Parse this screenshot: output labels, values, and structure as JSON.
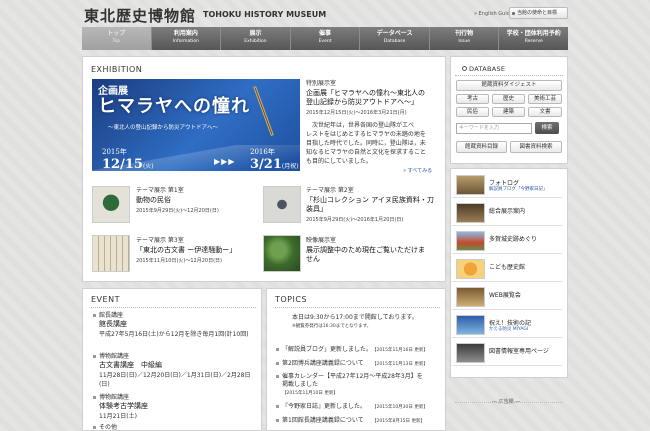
{
  "header": {
    "logo_jp": "東北歴史博物館",
    "logo_en": "TOHOKU HISTORY MUSEUM",
    "english_link": "» English Guide",
    "mission_button": "当館の使命と目標"
  },
  "nav": [
    {
      "jp": "トップ",
      "en": "Top",
      "active": true
    },
    {
      "jp": "利用案内",
      "en": "Information",
      "active": false
    },
    {
      "jp": "展示",
      "en": "Exhibition",
      "active": false
    },
    {
      "jp": "催事",
      "en": "Event",
      "active": false
    },
    {
      "jp": "データベース",
      "en": "Database",
      "active": false
    },
    {
      "jp": "刊行物",
      "en": "Issue",
      "active": false
    },
    {
      "jp": "学校・団体利用予約",
      "en": "Reserve",
      "active": false
    }
  ],
  "exhibition": {
    "section_title": "EXHIBITION",
    "banner": {
      "line1": "企画展",
      "line2": "ヒマラヤへの憧れ",
      "line3": "〜東北人の登山記録から防災アウトドアへ〜",
      "start_year": "2015年",
      "start_day": "12/15",
      "start_dow": "(火)",
      "end_year": "2016年",
      "end_day": "3/21",
      "end_dow": "(月祝)",
      "arrows": "▶▶▶"
    },
    "special": {
      "label": "特別展示室",
      "title_line1": "企画展「ヒマラヤへの憧れ〜東北人の",
      "title_line2": "登山記録から防災アウトドアへ〜」",
      "date": "2015年12月15日(火)〜2016年3月21日(月)",
      "body": [
        "　次世紀年は，世界各国の登山隊がエベ",
        "レストをはじめとするヒマラヤの未踏の地を",
        "目指した時代でした。同時に，登山隊は，未",
        "知なるヒマラヤの自然と文化を探求すること",
        "も目的にしていました。"
      ],
      "more": "» すべてみる"
    },
    "items": [
      {
        "label": "テーマ展示 第1室",
        "title": "動物の民俗",
        "date": "2015年9月29日(火)〜12月20日(日)"
      },
      {
        "label": "テーマ展示 第2室",
        "title_line1": "「杉山コレクション アイヌ民族資料・刀",
        "title_line2": "装具」",
        "date": "2015年9月29日(火)〜2016年1月20日(日)"
      },
      {
        "label": "テーマ展示 第3室",
        "title": "「東北の古文書 ー伊達騒動ー」",
        "date": "2015年11月10日(火)〜12月20日(日)"
      },
      {
        "label": "映像展示室",
        "title_line1": "展示調整中のため現在ご覧いただけま",
        "title_line2": "せん"
      }
    ]
  },
  "event": {
    "section_title": "EVENT",
    "items": [
      {
        "category": "館長講座",
        "title": "館長講座",
        "details": [
          "平成27年5月16日(土)から12月を除き毎月1回(計10回)"
        ]
      },
      {
        "category": "博物館講座",
        "title": "古文書講座　中級編",
        "details": [
          "11月28日(日)／12月20日(日)／1月31日(日)／2月28日(日)"
        ]
      },
      {
        "category": "博物館講座",
        "title": "体験考古学講座",
        "details": [
          "11月21日(土)"
        ]
      },
      {
        "category": "その他",
        "title": "",
        "details": []
      }
    ]
  },
  "topics": {
    "section_title": "TOPICS",
    "notice_line1": "本日は9:30から17:00まで開館しております。",
    "notice_line2": "※観覧券発行は16:30までとなります。",
    "items": [
      {
        "text": "「解説員ブログ」更新しました。",
        "date": "【2015年11月16日 更新】"
      },
      {
        "text": "第2回博兵講座講義録について",
        "date": "【2015年11月13日 更新】"
      },
      {
        "text_line1": "催事カレンダー【平成27年12月〜平成28年3月】を",
        "text_line2": "掲載しました",
        "date": "【2015年11月10日 更新】"
      },
      {
        "text": "『今野家日誌』更新しました。",
        "date": "【2015年10月30日 更新】"
      },
      {
        "text": "第1回館長講座講義録について",
        "date": "【2015年8月15日 更新】"
      }
    ]
  },
  "sidebar": {
    "database_title": "DATABASE",
    "digest_button": "館蔵資料ダイジェスト",
    "grid_buttons": [
      "考古",
      "歴史",
      "美術工芸",
      "民俗",
      "建築",
      "文書"
    ],
    "keyword_placeholder": "キーワードを入力",
    "search_button": "検索",
    "bottom_buttons": [
      "館蔵資料目録",
      "図書資料検索"
    ],
    "links": [
      {
        "label": "フォトログ",
        "sub": "解説員ブログ「今野家日記」"
      },
      {
        "label": "総合展示案内",
        "sub": ""
      },
      {
        "label": "多賀城史跡めぐり",
        "sub": ""
      },
      {
        "label": "こども歴史館",
        "sub": ""
      },
      {
        "label": "WEB展覧会",
        "sub": ""
      },
      {
        "label": "祝え！技術の記",
        "sub": "かえる防災 MIYAGI"
      },
      {
        "label": "図書情報室専用ページ",
        "sub": ""
      }
    ],
    "ad_label": "― 広告欄 ―"
  },
  "colors": {
    "nav_bg": "#5e5e5e",
    "link": "#2857a8",
    "banner": "#2a60b8"
  }
}
